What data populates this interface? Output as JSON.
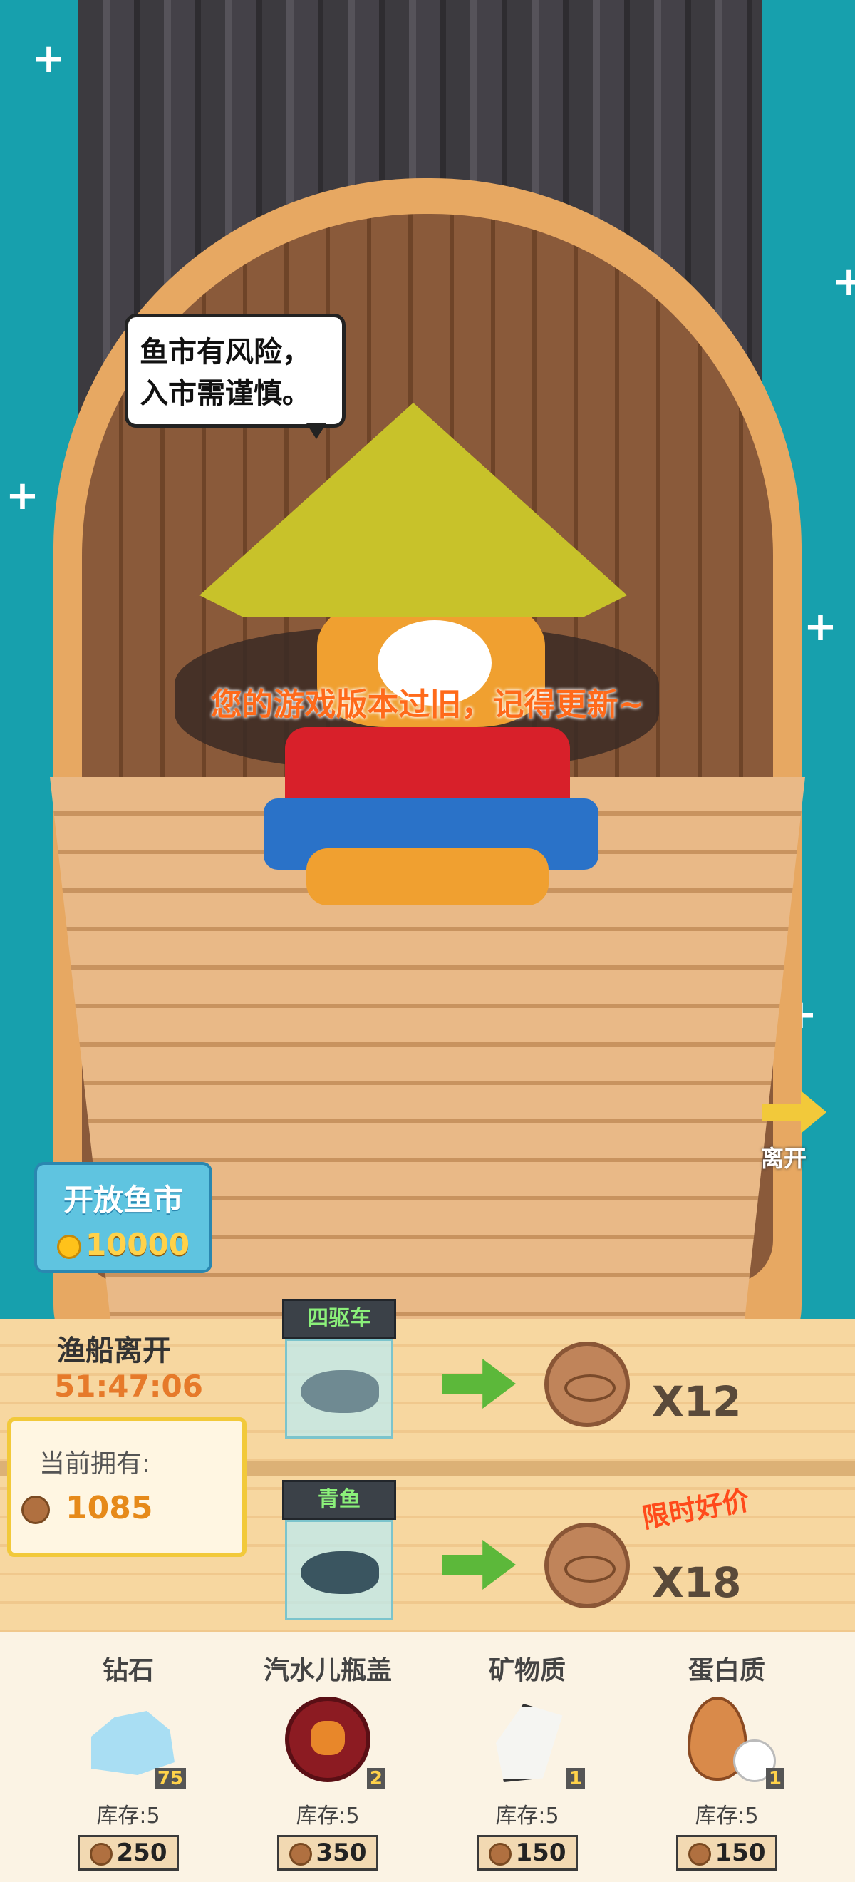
{
  "scene": {
    "speech_bubble": [
      "鱼市有风险，",
      "入市需谨慎。"
    ],
    "update_notice": "您的游戏版本过旧，记得更新~"
  },
  "open_market": {
    "title": "开放鱼市",
    "cost": "10000"
  },
  "leave_button": {
    "label": "离开"
  },
  "boat_timer": {
    "label": "渔船离开",
    "value": "51:47:06"
  },
  "owned": {
    "label": "当前拥有:",
    "value": "1085"
  },
  "trades": [
    {
      "fish_name": "四驱车",
      "reward_qty": "X12",
      "promo": ""
    },
    {
      "fish_name": "青鱼",
      "reward_qty": "X18",
      "promo": "限时好价"
    }
  ],
  "shop": [
    {
      "name": "钻石",
      "count": "75",
      "stock": "库存:5",
      "price": "250",
      "icon": "diamond-icon"
    },
    {
      "name": "汽水儿瓶盖",
      "count": "2",
      "stock": "库存:5",
      "price": "350",
      "icon": "bottle-cap-icon"
    },
    {
      "name": "矿物质",
      "count": "1",
      "stock": "库存:5",
      "price": "150",
      "icon": "mineral-icon"
    },
    {
      "name": "蛋白质",
      "count": "1",
      "stock": "库存:5",
      "price": "150",
      "icon": "egg-icon"
    }
  ],
  "colors": {
    "sea": "#17a0ad",
    "accent_orange": "#e67a2a",
    "promo_red": "#ff4a1a",
    "panel": "#f7d7a0"
  }
}
